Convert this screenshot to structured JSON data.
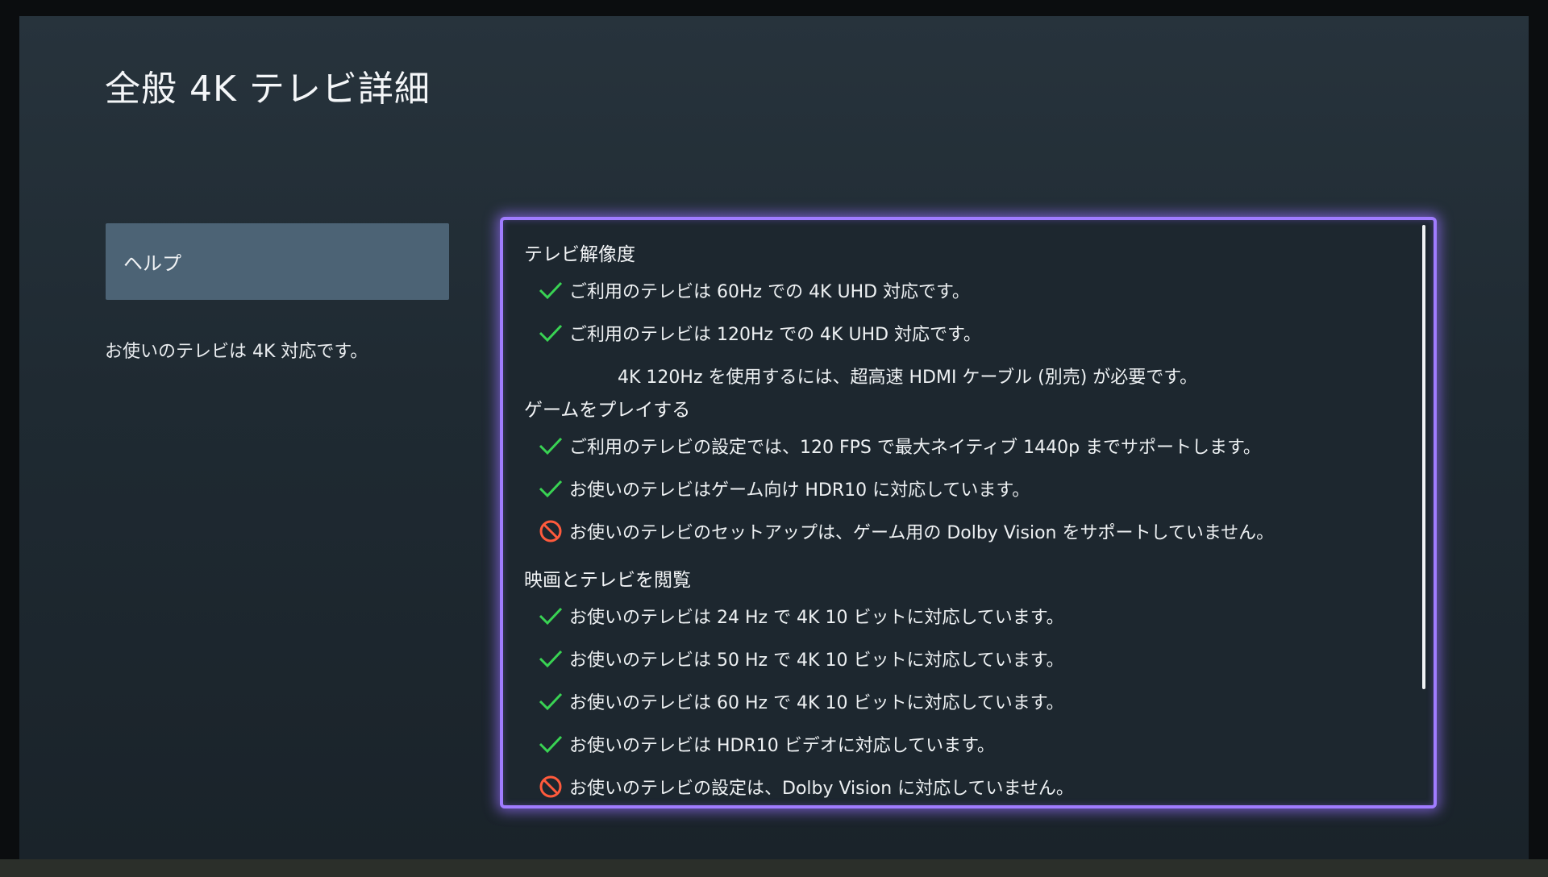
{
  "page": {
    "title": "全般 4K テレビ詳細"
  },
  "sidebar": {
    "help_button_label": "ヘルプ",
    "description": "お使いのテレビは 4K 対応です。"
  },
  "colors": {
    "accent_focus": "#a07cff",
    "check_green": "#39d353",
    "blocked_red": "#ff5a3c",
    "help_button_bg": "#4c6375"
  },
  "sections": {
    "tv_resolution": {
      "heading": "テレビ解像度",
      "items": [
        {
          "status": "check-icon",
          "text": "ご利用のテレビは 60Hz での 4K UHD 対応です。"
        },
        {
          "status": "check-icon",
          "text": "ご利用のテレビは 120Hz での 4K UHD 対応です。"
        }
      ],
      "note": "4K 120Hz を使用するには、超高速 HDMI ケーブル (別売) が必要です。"
    },
    "gaming": {
      "heading": "ゲームをプレイする",
      "items": [
        {
          "status": "check-icon",
          "text": "ご利用のテレビの設定では、120 FPS で最大ネイティブ 1440p までサポートします。"
        },
        {
          "status": "check-icon",
          "text": "お使いのテレビはゲーム向け HDR10 に対応しています。"
        },
        {
          "status": "blocked-icon",
          "text": "お使いのテレビのセットアップは、ゲーム用の Dolby Vision をサポートしていません。"
        }
      ]
    },
    "video": {
      "heading": "映画とテレビを閲覧",
      "items": [
        {
          "status": "check-icon",
          "text": "お使いのテレビは 24 Hz で 4K 10 ビットに対応しています。"
        },
        {
          "status": "check-icon",
          "text": "お使いのテレビは 50 Hz で 4K 10 ビットに対応しています。"
        },
        {
          "status": "check-icon",
          "text": "お使いのテレビは 60 Hz で 4K 10 ビットに対応しています。"
        },
        {
          "status": "check-icon",
          "text": "お使いのテレビは HDR10 ビデオに対応しています。"
        },
        {
          "status": "blocked-icon",
          "text": "お使いのテレビの設定は、Dolby Vision に対応していません。"
        }
      ]
    }
  }
}
